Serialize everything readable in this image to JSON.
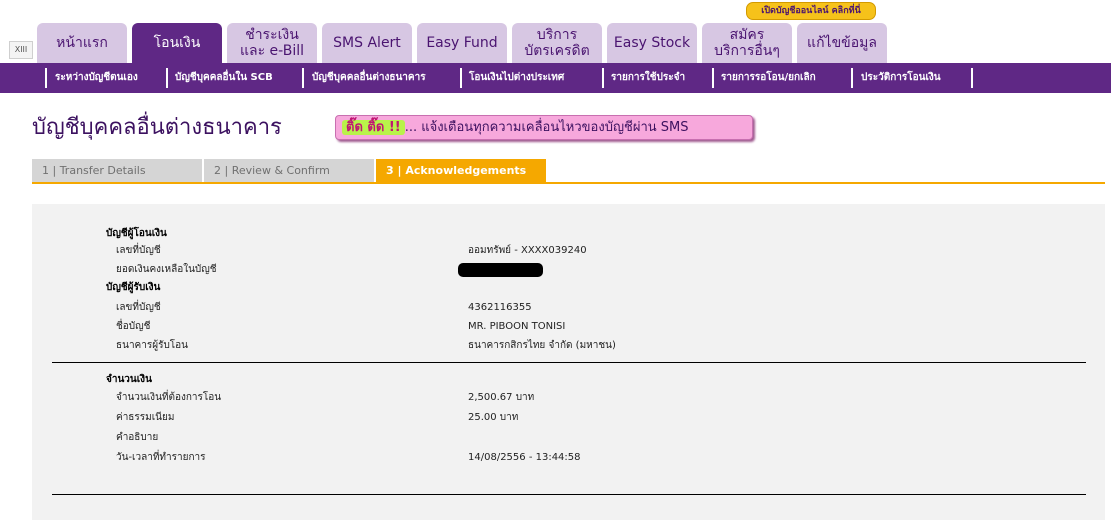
{
  "promo_badge": "เปิดบัญชีออนไลน์ คลิกที่นี่",
  "language_button": "XIII",
  "tabs": [
    {
      "lines": [
        "หน้าแรก"
      ]
    },
    {
      "lines": [
        "โอนเงิน"
      ]
    },
    {
      "lines": [
        "ชำระเงิน",
        "และ e-Bill"
      ]
    },
    {
      "lines": [
        "SMS Alert"
      ]
    },
    {
      "lines": [
        "Easy Fund"
      ]
    },
    {
      "lines": [
        "บริการ",
        "บัตรเครดิต"
      ]
    },
    {
      "lines": [
        "Easy Stock"
      ]
    },
    {
      "lines": [
        "สมัคร",
        "บริการอื่นๆ"
      ]
    },
    {
      "lines": [
        "แก้ไขข้อมูล"
      ]
    }
  ],
  "submenu": [
    "ระหว่างบัญชีตนเอง",
    "บัญชีบุคคลอื่นใน SCB",
    "บัญชีบุคคลอื่นต่างธนาคาร",
    "โอนเงินไปต่างประเทศ",
    "รายการใช้ประจำ",
    "รายการรอโอน/ยกเลิก",
    "ประวัติการโอนเงิน"
  ],
  "page_title": "บัญชีบุคคลอื่นต่างธนาคาร",
  "sms_banner": {
    "highlight": "ติ๊ด ติ๊ด !!",
    "text": "... แจ้งเตือนทุกความเคลื่อนไหวของบัญชีผ่าน SMS"
  },
  "steps": [
    "1 | Transfer Details",
    "2 | Review & Confirm",
    "3 | Acknowledgements"
  ],
  "details": {
    "from_header": "บัญชีผู้โอนเงิน",
    "from_account_label": "เลขที่บัญชี",
    "from_account_value": "ออมทรัพย์ - XXXX039240",
    "balance_label": "ยอดเงินคงเหลือในบัญชี",
    "to_header": "บัญชีผู้รับเงิน",
    "to_account_label": "เลขที่บัญชี",
    "to_account_value": "4362116355",
    "account_name_label": "ชื่อบัญชี",
    "account_name_value": "MR. PIBOON TONISI",
    "bank_label": "ธนาคารผู้รับโอน",
    "bank_value": "ธนาคารกสิกรไทย จำกัด (มหาชน)",
    "amount_header": "จำนวนเงิน",
    "amount_label": "จำนวนเงินที่ต้องการโอน",
    "amount_value": "2,500.67  บาท",
    "fee_label": "ค่าธรรมเนียม",
    "fee_value": "25.00  บาท",
    "desc_label": "คำอธิบาย",
    "datetime_label": "วัน-เวลาที่ทำรายการ",
    "datetime_value": "14/08/2556 - 13:44:58"
  }
}
